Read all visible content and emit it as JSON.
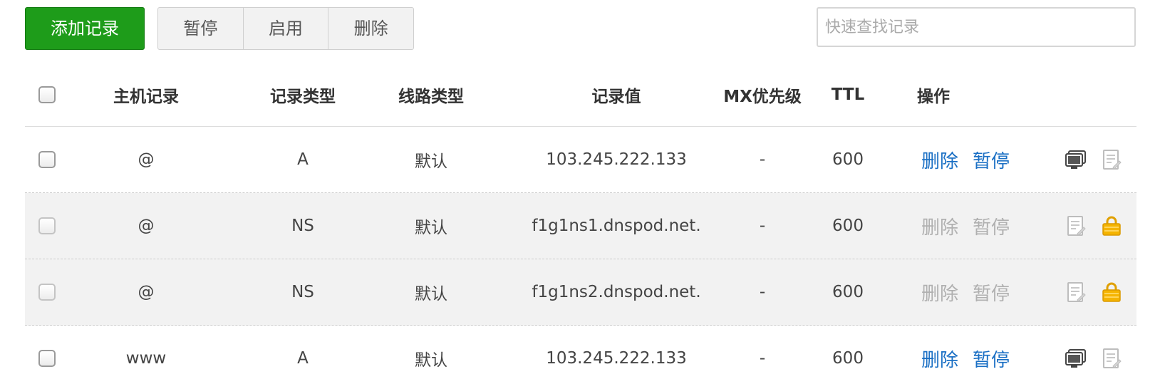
{
  "toolbar": {
    "add_label": "添加记录",
    "pause_label": "暂停",
    "enable_label": "启用",
    "delete_label": "删除",
    "search_placeholder": "快速查找记录"
  },
  "table": {
    "headers": {
      "host": "主机记录",
      "type": "记录类型",
      "line": "线路类型",
      "value": "记录值",
      "mx": "MX优先级",
      "ttl": "TTL",
      "op": "操作"
    },
    "rows": [
      {
        "host": "@",
        "type": "A",
        "line": "默认",
        "value": "103.245.222.133",
        "mx": "-",
        "ttl": "600",
        "delete": "删除",
        "pause": "暂停",
        "locked": false
      },
      {
        "host": "@",
        "type": "NS",
        "line": "默认",
        "value": "f1g1ns1.dnspod.net.",
        "mx": "-",
        "ttl": "600",
        "delete": "删除",
        "pause": "暂停",
        "locked": true
      },
      {
        "host": "@",
        "type": "NS",
        "line": "默认",
        "value": "f1g1ns2.dnspod.net.",
        "mx": "-",
        "ttl": "600",
        "delete": "删除",
        "pause": "暂停",
        "locked": true
      },
      {
        "host": "www",
        "type": "A",
        "line": "默认",
        "value": "103.245.222.133",
        "mx": "-",
        "ttl": "600",
        "delete": "删除",
        "pause": "暂停",
        "locked": false
      }
    ]
  },
  "colors": {
    "add_button": "#1e9c1a",
    "link_active": "#1a6fc4",
    "link_disabled": "#b0b0b0",
    "lock_icon": "#f5b400"
  },
  "icons": [
    "monitor-icon",
    "note-icon",
    "lock-icon"
  ]
}
